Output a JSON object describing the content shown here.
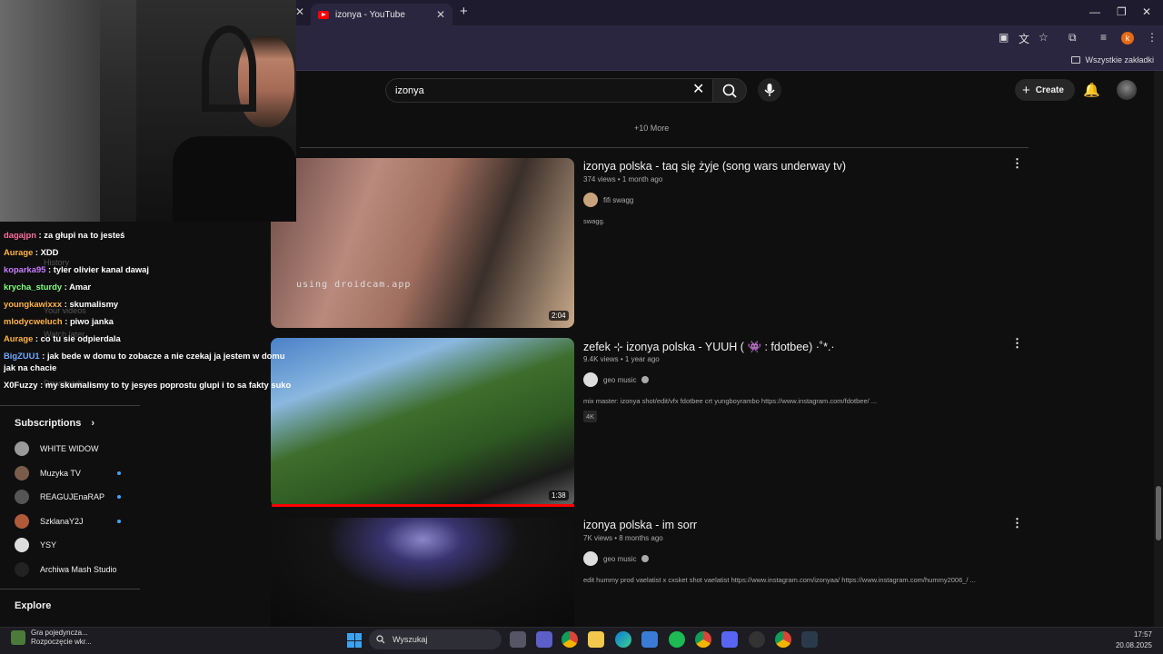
{
  "browser": {
    "tab_title": "izonya - YouTube",
    "bookmarks_folder": "Wszystkie zakładki",
    "profile_initial": "k"
  },
  "youtube": {
    "search_query": "izonya",
    "create_label": "Create",
    "more_link": "+10 More"
  },
  "videos": [
    {
      "title": "izonya polska - taq się żyje (song wars underway tv)",
      "meta": "374 views • 1 month ago",
      "channel": "fifi swagg",
      "description": "swagg.",
      "duration": "2:04",
      "thumb_overlay_text": "using droidcam.app"
    },
    {
      "title": "zefek ⊹ izonya polska - YUUH ( 👾 : fdotbee) ·˚*.·",
      "meta": "9.4K views • 1 year ago",
      "channel": "geo music",
      "description": "mix master: izonya shot/edit/vfx fdotbee crt yungboyrambo https://www.instagram.com/fdotbee/ ...",
      "badge": "4K",
      "duration": "1:38",
      "watched_fraction": 1.0
    },
    {
      "title": "izonya polska - im sorr",
      "meta": "7K views • 8 months ago",
      "channel": "geo music",
      "description": "edit hummy prod vaelatist x cxsket shot vaelatist https://www.instagram.com/izonyaa/ https://www.instagram.com/hummy2006_/ ..."
    }
  ],
  "chat": [
    {
      "user": "dagajpn",
      "message": "za głupi na to jesteś",
      "color": "#ff6f9f"
    },
    {
      "user": "Aurage",
      "message": "XDD",
      "color": "#ffb347"
    },
    {
      "user": "koparka95",
      "message": "tyler olivier kanal dawaj",
      "color": "#c77dff"
    },
    {
      "user": "krycha_sturdy",
      "message": "Amar",
      "color": "#7dff7d"
    },
    {
      "user": "youngkawixxx",
      "message": "skumalismy",
      "color": "#ffb347"
    },
    {
      "user": "mlodycweluch",
      "message": "piwo janka",
      "color": "#ffb347"
    },
    {
      "user": "Aurage",
      "message": "co tu sie odpierdala",
      "color": "#ffb347"
    },
    {
      "user": "BigZUU1",
      "message": "jak bede w domu to zobacze a nie czekaj ja jestem w domu jak na chacie",
      "color": "#6fa8ff"
    },
    {
      "user": "X0Fuzzy",
      "message": "my skumalismy to ty jesyes poprostu glupi i to sa fakty suko",
      "color": "#ffffff"
    }
  ],
  "sidebar": {
    "ghost_items": [
      "History",
      "Your videos",
      "Watch later",
      "Downloads"
    ],
    "subscriptions_heading": "Subscriptions",
    "subscriptions": [
      {
        "name": "WHITE WIDOW",
        "live": false,
        "color": "#999999"
      },
      {
        "name": "Muzyka TV",
        "live": true,
        "color": "#7a5c4a"
      },
      {
        "name": "REAGUJEnaRAP",
        "live": true,
        "color": "#555555"
      },
      {
        "name": "SzklanaY2J",
        "live": true,
        "color": "#b05a3a"
      },
      {
        "name": "YSY",
        "live": false,
        "color": "#dddddd"
      },
      {
        "name": "Archiwa Mash Studio",
        "live": false,
        "color": "#222222"
      }
    ],
    "explore_heading": "Explore"
  },
  "taskbar": {
    "notification_title": "Gra pojedyncza...",
    "notification_sub": "Rozpoczęcie wkr...",
    "search_placeholder": "Wyszukaj",
    "time": "17:57",
    "date": "20.08.2025"
  }
}
